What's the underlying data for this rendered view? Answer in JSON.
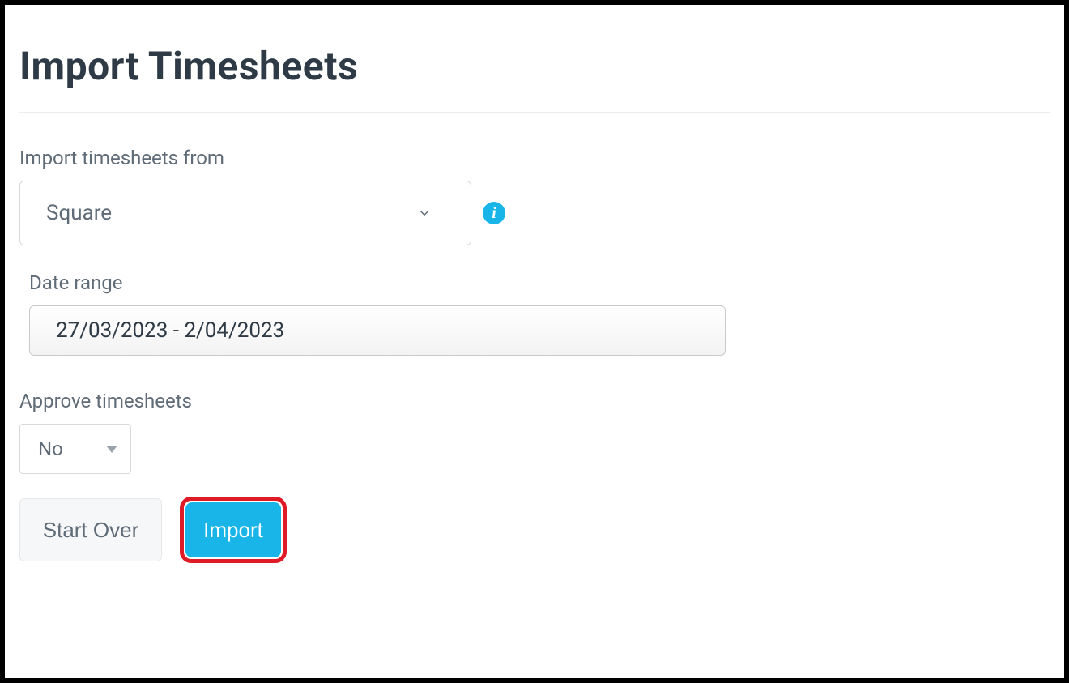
{
  "page": {
    "title": "Import Timesheets"
  },
  "fields": {
    "source": {
      "label": "Import timesheets from",
      "value": "Square"
    },
    "dateRange": {
      "label": "Date range",
      "value": "27/03/2023 -  2/04/2023"
    },
    "approve": {
      "label": "Approve timesheets",
      "value": "No"
    }
  },
  "buttons": {
    "startOver": "Start Over",
    "import": "Import"
  },
  "icons": {
    "info": "i"
  }
}
